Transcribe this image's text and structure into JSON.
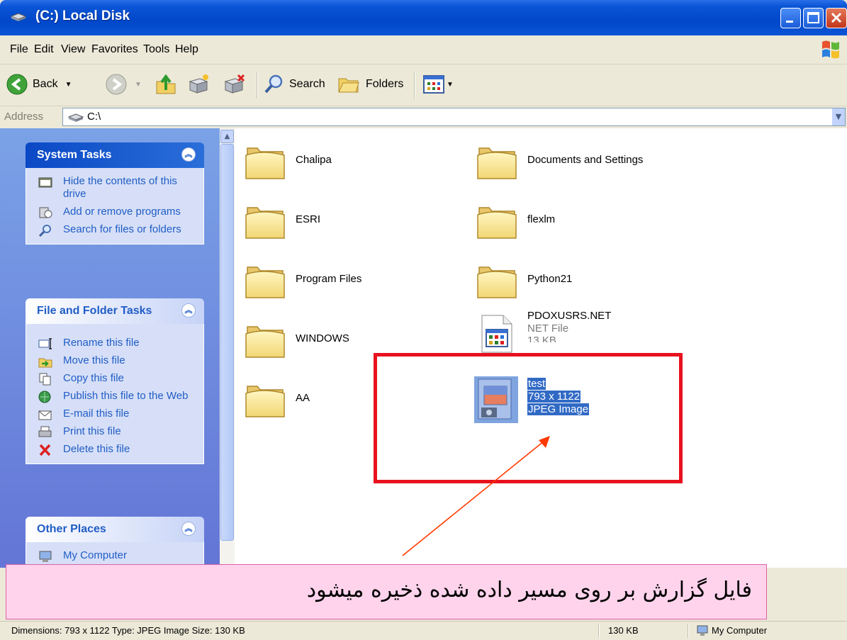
{
  "window": {
    "title": "(C:) Local Disk"
  },
  "menu": [
    "File",
    "Edit",
    "View",
    "Favorites",
    "Tools",
    "Help"
  ],
  "toolbar": {
    "back_label": "Back",
    "search_label": "Search",
    "folders_label": "Folders"
  },
  "address": {
    "label": "Address",
    "value": "C:\\"
  },
  "left_panel": {
    "system_tasks": {
      "title": "System Tasks",
      "items": [
        "Hide the contents of this drive",
        "Add or remove programs",
        "Search for files or folders"
      ]
    },
    "file_folder_tasks": {
      "title": "File and Folder Tasks",
      "items": [
        "Rename this file",
        "Move this file",
        "Copy this file",
        "Publish this file to the Web",
        "E-mail this file",
        "Print this file",
        "Delete this file"
      ]
    },
    "other_places": {
      "title": "Other Places",
      "items": [
        "My Computer"
      ]
    }
  },
  "files": {
    "folders": [
      "Chalipa",
      "Documents and Settings",
      "ESRI",
      "flexlm",
      "Program Files",
      "Python21",
      "WINDOWS",
      "AA"
    ],
    "pdox": {
      "name": "PDOXUSRS.NET",
      "type": "NET File",
      "size": "13 KB"
    },
    "test": {
      "name": "test",
      "dims": "793 x 1122",
      "type": "JPEG Image"
    }
  },
  "status": {
    "details": "Dimensions: 793 x 1122 Type: JPEG Image Size: 130 KB",
    "size": "130 KB",
    "zone": "My Computer"
  },
  "caption": "فایل گزارش بر روی مسیر داده شده ذخیره میشود",
  "colors": {
    "highlight_box": "#e8111e",
    "selection": "#316ac5",
    "caption_bg": "#ffd3ec",
    "title_bar": "#0a55d6"
  }
}
